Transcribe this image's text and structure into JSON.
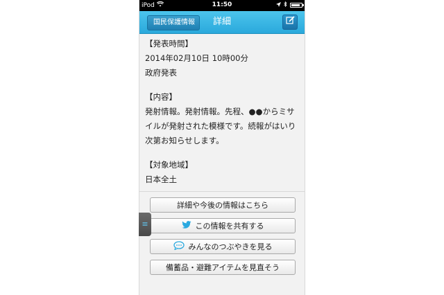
{
  "status_bar": {
    "carrier": "iPod",
    "time": "11:50"
  },
  "nav_bar": {
    "back_label": "国民保護情報",
    "title": "詳細"
  },
  "sections": [
    {
      "heading": "【発表時間】",
      "lines": [
        "2014年02月10日 10時00分",
        "政府発表"
      ]
    },
    {
      "heading": "【内容】",
      "text": "発射情報。発射情報。先程、●●からミサイルが発射された模様です。続報がはいり次第お知らせします。"
    },
    {
      "heading": "【対象地域】",
      "lines": [
        "日本全土"
      ]
    }
  ],
  "buttons": [
    {
      "label": "詳細や今後の情報はこちら",
      "icon": ""
    },
    {
      "label": "この情報を共有する",
      "icon": "twitter-bird-icon"
    },
    {
      "label": "みんなのつぶやきを見る",
      "icon": "speech-bubble-icon"
    },
    {
      "label": "備蓄品・避難アイテムを見直そう",
      "icon": ""
    }
  ],
  "colors": {
    "nav_bar": "#2aa9dc",
    "back_button": "#1f80b3",
    "accent_icon": "#2aa9e0",
    "background": "#f2f2f2"
  }
}
